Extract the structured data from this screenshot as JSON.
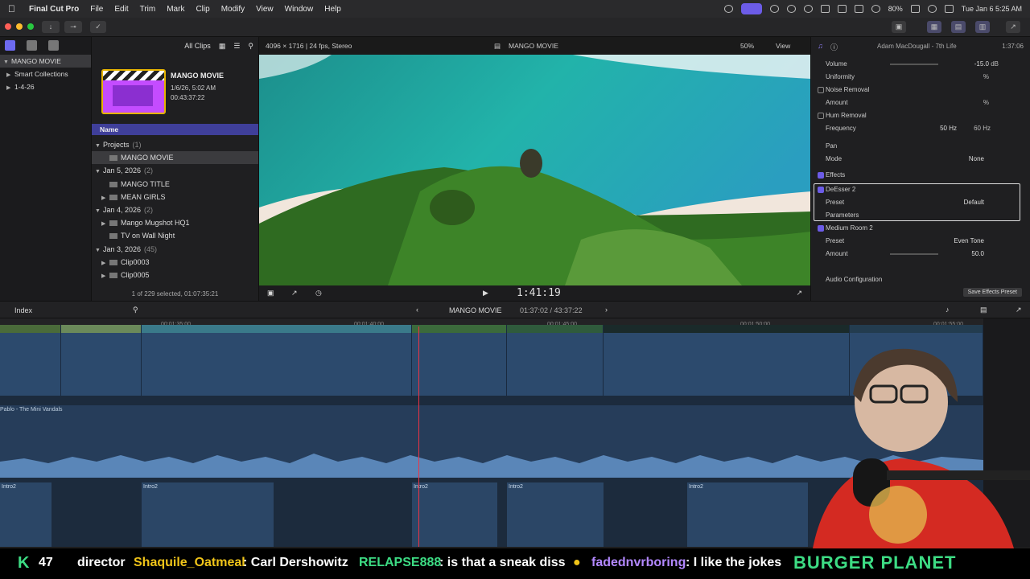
{
  "menubar": {
    "app_name": "Final Cut Pro",
    "menus": [
      "File",
      "Edit",
      "Trim",
      "Mark",
      "Clip",
      "Modify",
      "View",
      "Window",
      "Help"
    ],
    "battery": "80%",
    "datetime": "Tue Jan 6  5:25 AM"
  },
  "sidebar": {
    "items": [
      {
        "label": "MANGO MOVIE",
        "selected": true
      },
      {
        "label": "Smart Collections"
      },
      {
        "label": "1-4-26"
      }
    ]
  },
  "browser": {
    "filter": "All Clips",
    "clip": {
      "title": "MANGO MOVIE",
      "date": "1/6/26, 5:02 AM",
      "duration": "00:43:37:22"
    },
    "column_header": "Name",
    "rows": [
      {
        "label": "Projects",
        "count": "(1)",
        "type": "group"
      },
      {
        "label": "MANGO MOVIE",
        "type": "project",
        "selected": true
      },
      {
        "label": "Jan 5, 2026",
        "count": "(2)",
        "type": "group"
      },
      {
        "label": "MANGO TITLE",
        "type": "project"
      },
      {
        "label": "MEAN GIRLS",
        "type": "clip"
      },
      {
        "label": "Jan 4, 2026",
        "count": "(2)",
        "type": "group"
      },
      {
        "label": "Mango Mugshot HQ1",
        "type": "clip"
      },
      {
        "label": "TV on Wall Night",
        "type": "project"
      },
      {
        "label": "Jan 3, 2026",
        "count": "(45)",
        "type": "group"
      },
      {
        "label": "Clip0003",
        "type": "clip"
      },
      {
        "label": "Clip0005",
        "type": "clip"
      }
    ],
    "status": "1 of 229 selected, 01:07:35:21"
  },
  "viewer": {
    "format": "4096 × 1716 | 24 fps, Stereo",
    "title": "MANGO MOVIE",
    "zoom": "50%",
    "view_label": "View",
    "timecode": "1:41:19"
  },
  "inspector": {
    "track_name": "Adam MacDougall - 7th Life",
    "duration": "1:37:06",
    "rows": [
      {
        "label": "Volume",
        "value": "-15.0",
        "unit": "dB"
      },
      {
        "label": "Uniformity",
        "value": "",
        "unit": "%"
      },
      {
        "label": "Noise Removal",
        "check": true
      },
      {
        "label": "Amount",
        "value": "",
        "unit": "%"
      },
      {
        "label": "Hum Removal",
        "check": true
      },
      {
        "label": "Frequency",
        "value": "50 Hz",
        "unit": "60 Hz"
      },
      {
        "label": "Pan"
      },
      {
        "label": "Mode",
        "value": "None"
      },
      {
        "label": "Effects",
        "check": true,
        "on": true
      },
      {
        "label": "DeEsser 2",
        "check": true,
        "on": true
      },
      {
        "label": "Preset",
        "value": "Default"
      },
      {
        "label": "Parameters"
      },
      {
        "label": "Medium Room 2",
        "check": true,
        "on": true
      },
      {
        "label": "Preset",
        "value": "Even Tone"
      },
      {
        "label": "Amount",
        "value": "50.0"
      }
    ],
    "audio_config": "Audio Configuration",
    "save_preset": "Save Effects Preset"
  },
  "timeline_bar": {
    "index_label": "Index",
    "project": "MANGO MOVIE",
    "timecode": "01:37:02 / 43:37:22"
  },
  "timeline": {
    "ruler": [
      "00:01:35:00",
      "00:01:40:00",
      "00:01:45:00",
      "00:01:50:00",
      "00:01:55:00"
    ],
    "music_label": "Pablo - The Mini Vandals",
    "audio_clip_label": "Intro2"
  },
  "chat": {
    "count": "47",
    "items": [
      {
        "text": "director",
        "color": "#ffffff"
      },
      {
        "user": "Shaquile_Oatmeal",
        "msg": ": Carl Dershowitz",
        "color": "#f0c419"
      },
      {
        "user": "RELAPSE888",
        "msg": ": is that a sneak diss",
        "color": "#3ddc84"
      },
      {
        "user": "fadednvrboring",
        "msg": ": I like the jokes",
        "color": "#b388ff"
      }
    ],
    "brand": "BURGER PLANET"
  }
}
